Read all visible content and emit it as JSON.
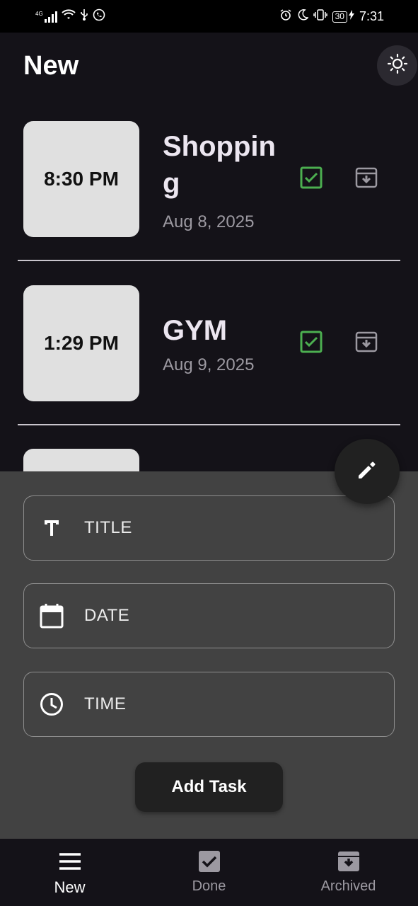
{
  "status_bar": {
    "network": "4G",
    "battery": "30",
    "time": "7:31",
    "left_icons": [
      "signal-icon",
      "wifi-icon",
      "usb-icon",
      "whatsapp-icon"
    ],
    "right_icons": [
      "alarm-icon",
      "moon-icon",
      "vibrate-icon",
      "battery-icon",
      "charging-icon"
    ]
  },
  "appbar": {
    "title": "New",
    "theme_toggle_icon": "sun-icon"
  },
  "tasks": [
    {
      "time": "8:30 PM",
      "title": "Shopping",
      "date": "Aug 8, 2025"
    },
    {
      "time": "1:29 PM",
      "title": "GYM",
      "date": "Aug 9, 2025"
    }
  ],
  "form": {
    "title_label": "TITLE",
    "date_label": "DATE",
    "time_label": "TIME",
    "submit_label": "Add Task"
  },
  "fab_icon": "pencil-icon",
  "bottom_nav": {
    "items": [
      {
        "label": "New",
        "icon": "menu-icon",
        "active": true
      },
      {
        "label": "Done",
        "icon": "check-box-icon",
        "active": false
      },
      {
        "label": "Archived",
        "icon": "archive-icon",
        "active": false
      }
    ]
  },
  "colors": {
    "background": "#141218",
    "sheet": "#424242",
    "done_check": "#4caf50",
    "time_box": "#e0e0e0"
  }
}
